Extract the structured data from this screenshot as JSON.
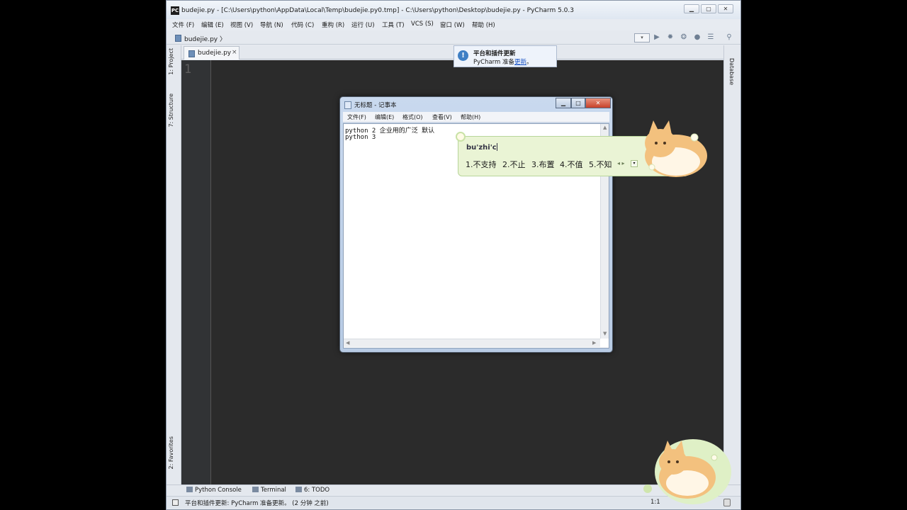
{
  "pycharm": {
    "title": "budejie.py - [C:\\Users\\python\\AppData\\Local\\Temp\\budejie.py0.tmp] - C:\\Users\\python\\Desktop\\budejie.py - PyCharm 5.0.3",
    "app_icon": "PC",
    "window_buttons": {
      "minimize": "▁",
      "maximize": "▢",
      "close": "✕"
    },
    "menu": [
      "文件 (F)",
      "编辑 (E)",
      "视图 (V)",
      "导航 (N)",
      "代码 (C)",
      "重构 (R)",
      "运行 (U)",
      "工具 (T)",
      "VCS (S)",
      "窗口 (W)",
      "帮助 (H)"
    ],
    "breadcrumb": "budejie.py 〉",
    "toolbar_icons": [
      "run-config-dropdown",
      "run-icon",
      "debug-icon",
      "coverage-icon",
      "stop-icon",
      "structure-icon",
      "search-icon"
    ],
    "left_tabs": {
      "project": "1: Project",
      "structure": "7: Structure",
      "favorites": "2: Favorites"
    },
    "right_tabs": {
      "database": "Database"
    },
    "editor_tab": {
      "label": "budejie.py",
      "close": "×"
    },
    "line_number": "1",
    "notification": {
      "icon": "!",
      "title": "平台和插件更新",
      "body_prefix": "PyCharm 准备",
      "link": "更新",
      "suffix": "。"
    },
    "bottom_tools": [
      "Python Console",
      "Terminal",
      "6: TODO"
    ],
    "status_text": "平台和插件更新: PyCharm 准备更新。 (2 分钟 之前)",
    "status_position": "1:1"
  },
  "notepad": {
    "title": "无标题 - 记事本",
    "buttons": {
      "minimize": "▁",
      "maximize": "□",
      "close": "✕"
    },
    "menu": [
      "文件(F)",
      "编辑(E)",
      "格式(O)",
      "查看(V)",
      "帮助(H)"
    ],
    "lines": [
      "python 2 企业用的广泛 默认",
      "python 3"
    ]
  },
  "ime": {
    "composition": "bu'zhi'c",
    "candidates": [
      "1.不支持",
      "2.不止",
      "3.布置",
      "4.不值",
      "5.不知"
    ],
    "more": "◂ ▸",
    "menu": "▾"
  }
}
